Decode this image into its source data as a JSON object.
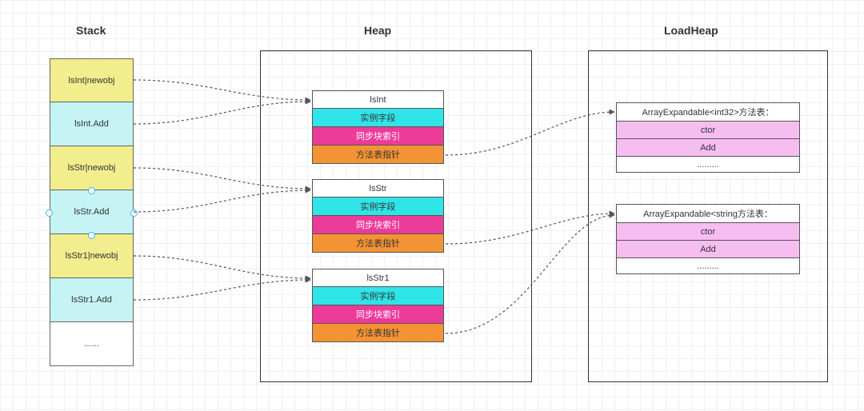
{
  "titles": {
    "stack": "Stack",
    "heap": "Heap",
    "loadheap": "LoadHeap"
  },
  "stack_cells": [
    {
      "label": "lsInt|newobj",
      "color": "c-yellow"
    },
    {
      "label": "lsInt.Add",
      "color": "c-cyan"
    },
    {
      "label": "lsStr|newobj",
      "color": "c-yellow"
    },
    {
      "label": "lsStr.Add",
      "color": "c-cyan"
    },
    {
      "label": "lsStr1|newobj",
      "color": "c-yellow"
    },
    {
      "label": "lsStr1.Add",
      "color": "c-cyan"
    },
    {
      "label": "......",
      "color": "c-white"
    }
  ],
  "heap_objects": [
    {
      "name": "lsInt",
      "rows": [
        "实例字段",
        "同步块索引",
        "方法表指针"
      ]
    },
    {
      "name": "lsStr",
      "rows": [
        "实例字段",
        "同步块索引",
        "方法表指针"
      ]
    },
    {
      "name": "lsStr1",
      "rows": [
        "实例字段",
        "同步块索引",
        "方法表指针"
      ]
    }
  ],
  "loadheap_tables": [
    {
      "header": "ArrayExpandable<int32>方法表：",
      "rows": [
        "ctor",
        "Add"
      ],
      "footer": "........."
    },
    {
      "header": "ArrayExpandable<string方法表：",
      "rows": [
        "ctor",
        "Add"
      ],
      "footer": "........."
    }
  ],
  "colors": {
    "dash": "#666"
  }
}
